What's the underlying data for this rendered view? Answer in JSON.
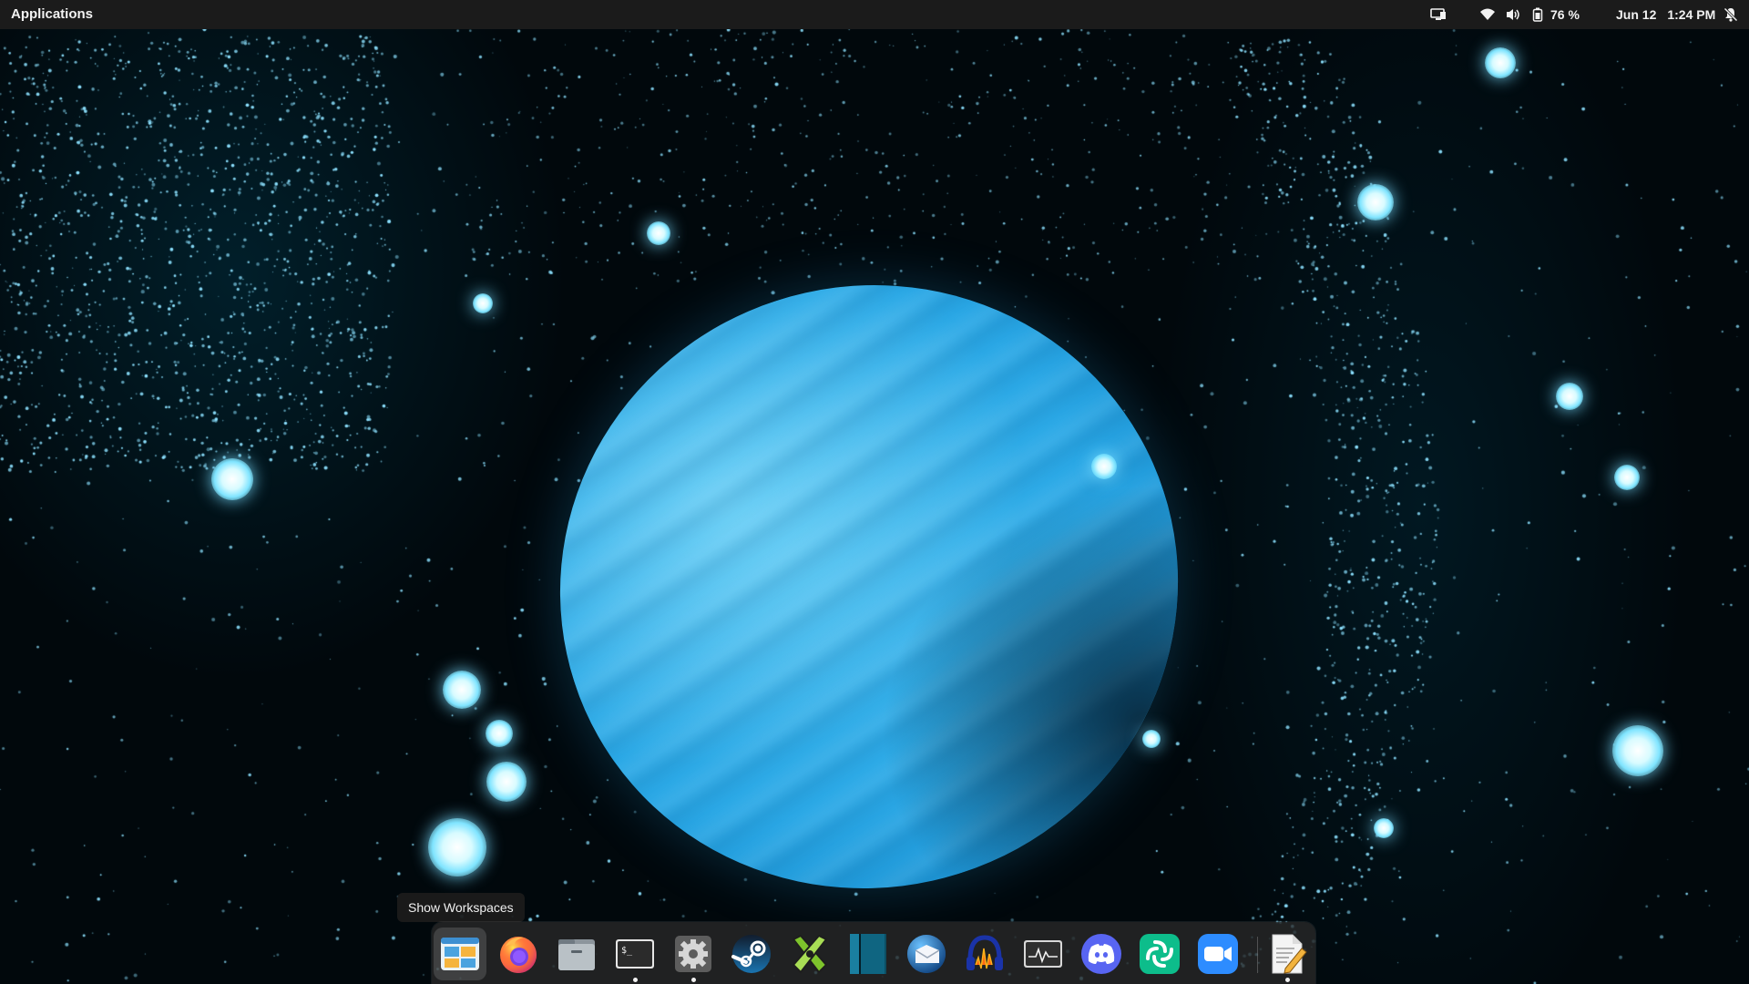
{
  "panel": {
    "applications_label": "Applications",
    "battery_label": "76 %",
    "date": "Jun 12",
    "time": "1:24 PM",
    "indicators": [
      "display-icon",
      "wifi-icon",
      "volume-icon",
      "battery-icon",
      "notifications-disabled-icon"
    ]
  },
  "tooltip": {
    "text": "Show Workspaces"
  },
  "dock": {
    "items": [
      {
        "name": "workspaces-icon",
        "active": true,
        "running": false
      },
      {
        "name": "firefox-icon",
        "active": false,
        "running": false
      },
      {
        "name": "files-icon",
        "active": false,
        "running": false
      },
      {
        "name": "terminal-icon",
        "active": false,
        "running": true
      },
      {
        "name": "settings-icon",
        "active": false,
        "running": true
      },
      {
        "name": "steam-icon",
        "active": false,
        "running": false
      },
      {
        "name": "inkscape-icon",
        "active": false,
        "running": false
      },
      {
        "name": "darktable-icon",
        "active": false,
        "running": false
      },
      {
        "name": "mail-icon",
        "active": false,
        "running": false
      },
      {
        "name": "audacity-icon",
        "active": false,
        "running": false
      },
      {
        "name": "system-monitor-icon",
        "active": false,
        "running": false
      },
      {
        "name": "discord-icon",
        "active": false,
        "running": false
      },
      {
        "name": "element-icon",
        "active": false,
        "running": false
      },
      {
        "name": "zoom-icon",
        "active": false,
        "running": false
      },
      {
        "name": "text-editor-icon",
        "active": false,
        "running": true
      }
    ],
    "terminal_prompt": "$_"
  },
  "colors": {
    "panel_bg": "#1b1b1b",
    "planet": "#2aa8e6",
    "particles": "#7fe4ff"
  }
}
